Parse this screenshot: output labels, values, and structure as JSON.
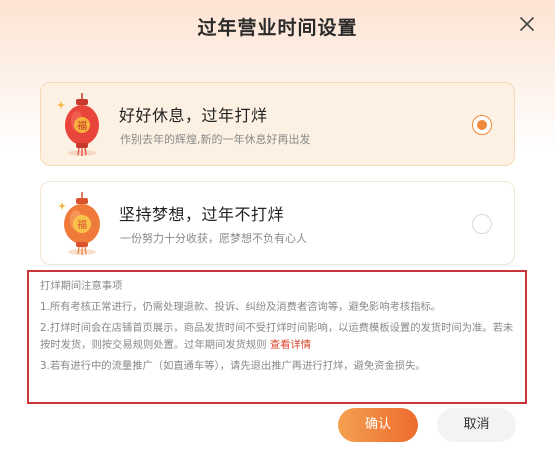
{
  "dialog": {
    "title": "过年营业时间设置",
    "close_icon": "close-icon"
  },
  "options": [
    {
      "title": "好好休息，过年打烊",
      "subtitle": "作别去年的辉煌,新的一年休息好再出发",
      "icon": "red-lantern-icon",
      "selected": true
    },
    {
      "title": "坚持梦想，过年不打烊",
      "subtitle": "一份努力十分收获，愿梦想不负有心人",
      "icon": "orange-lantern-icon",
      "selected": false
    }
  ],
  "notes": {
    "heading": "打烊期间注意事项",
    "item1": "1.所有考核正常进行，仍需处理退款、投诉、纠纷及消费者咨询等，避免影响考核指标。",
    "item2": "2.打烊时间会在店铺首页展示，商品发货时间不受打烊时间影响，以运费模板设置的发货时间为准。若未按时发货，则按交易规则处置。过年期间发货规则",
    "item2_link": "查看详情",
    "item3": "3.若有进行中的流量推广（如直通车等），请先退出推广再进行打烊，避免资金损失。"
  },
  "buttons": {
    "confirm": "确认",
    "cancel": "取消"
  },
  "colors": {
    "accent": "#f08a3c",
    "highlight_border": "#c9363a",
    "link": "#d9442f"
  }
}
